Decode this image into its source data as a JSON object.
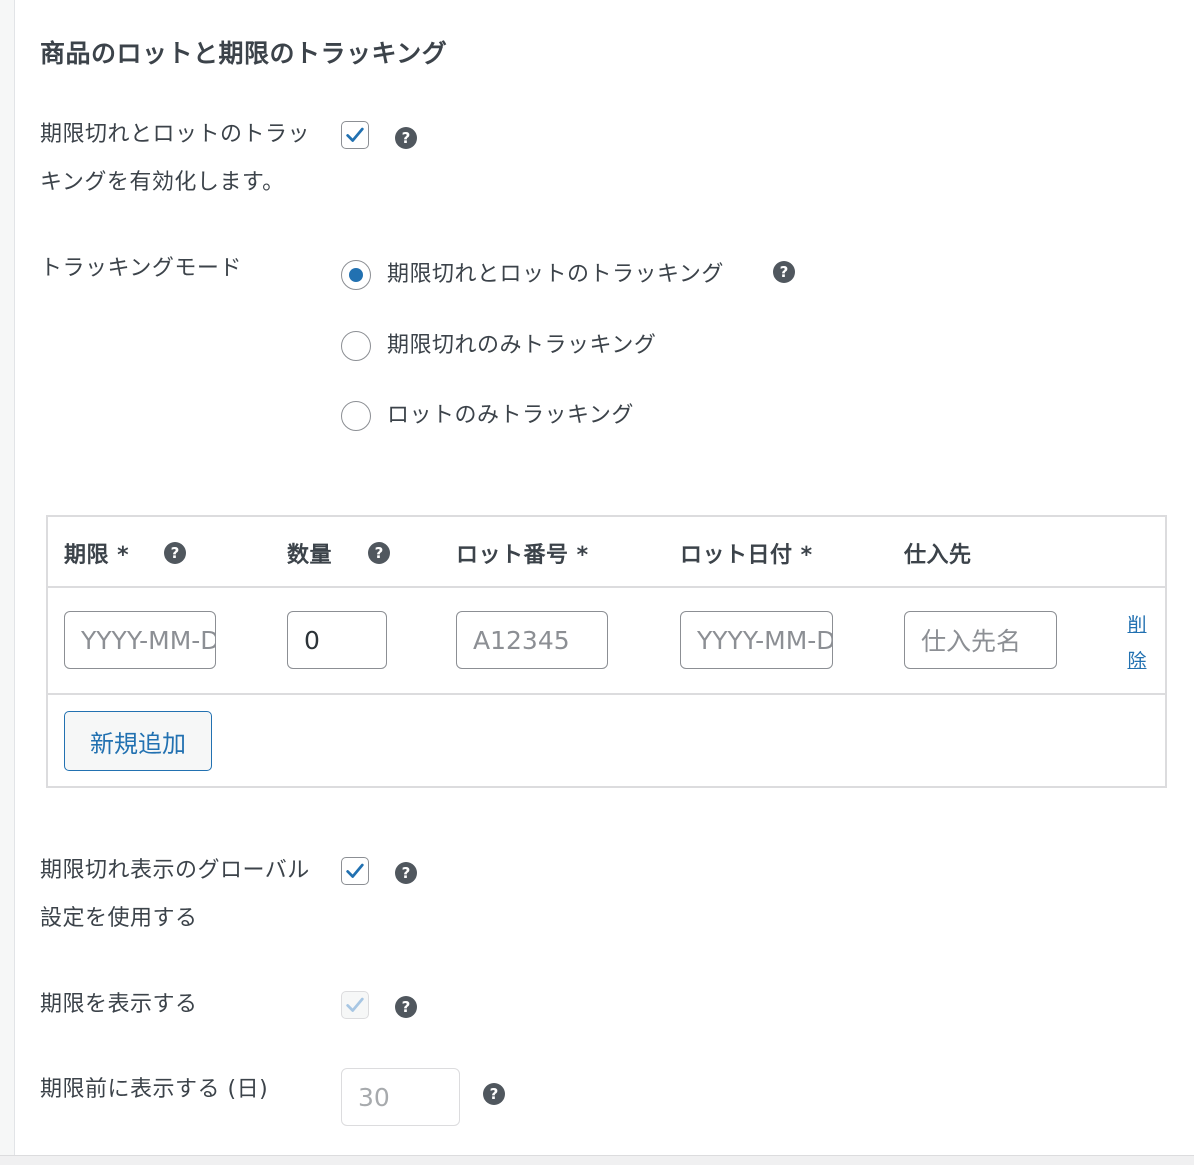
{
  "section": {
    "title": "商品のロットと期限のトラッキング"
  },
  "enable_tracking": {
    "label_line1": "期限切れとロットのトラッ",
    "label_line2": "キングを有効化します。",
    "checked": true
  },
  "tracking_mode": {
    "label": "トラッキングモード",
    "options": [
      {
        "label": "期限切れとロットのトラッキング",
        "selected": true
      },
      {
        "label": "期限切れのみトラッキング",
        "selected": false
      },
      {
        "label": "ロットのみトラッキング",
        "selected": false
      }
    ]
  },
  "lot_table": {
    "headers": {
      "expiry": "期限 *",
      "quantity": "数量",
      "lot_number": "ロット番号 *",
      "lot_date": "ロット日付 *",
      "supplier": "仕入先"
    },
    "row": {
      "expiry_placeholder": "YYYY-MM-DD",
      "quantity_value": "0",
      "lot_number_placeholder": "A12345",
      "lot_date_placeholder": "YYYY-MM-DD",
      "supplier_placeholder": "仕入先名",
      "delete_label_1": "削",
      "delete_label_2": "除"
    },
    "add_button": "新規追加"
  },
  "global_display": {
    "label_line1": "期限切れ表示のグローバル",
    "label_line2": "設定を使用する",
    "checked": true
  },
  "show_expiry": {
    "label": "期限を表示する",
    "checked": true,
    "disabled": true
  },
  "days_before": {
    "label": "期限前に表示する (日)",
    "value": "30",
    "disabled": true
  },
  "help_icon_glyph": "?",
  "colors": {
    "accent": "#2271b1",
    "text": "#3c434a",
    "help_bg": "#50575e",
    "border": "#dcdcde"
  }
}
